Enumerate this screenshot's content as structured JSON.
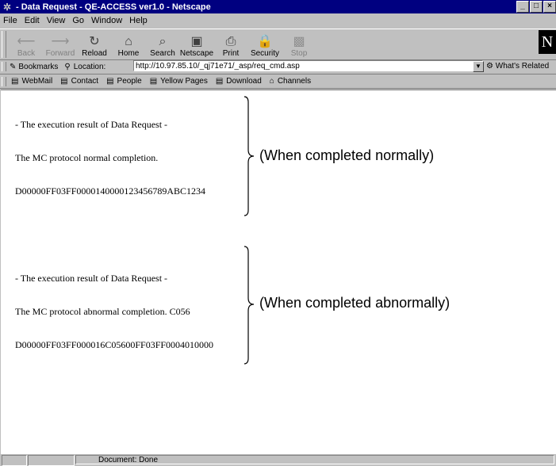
{
  "window": {
    "title": "- Data Request - QE-ACCESS ver1.0 - Netscape"
  },
  "menu": [
    "File",
    "Edit",
    "View",
    "Go",
    "Window",
    "Help"
  ],
  "toolbar": [
    {
      "label": "Back",
      "icon": "back-arrow-icon",
      "glyph": "⟵",
      "enabled": false
    },
    {
      "label": "Forward",
      "icon": "forward-arrow-icon",
      "glyph": "⟶",
      "enabled": false
    },
    {
      "label": "Reload",
      "icon": "reload-icon",
      "glyph": "↻",
      "enabled": true
    },
    {
      "label": "Home",
      "icon": "home-icon",
      "glyph": "⌂",
      "enabled": true
    },
    {
      "label": "Search",
      "icon": "search-icon",
      "glyph": "⌕",
      "enabled": true
    },
    {
      "label": "Netscape",
      "icon": "netscape-icon",
      "glyph": "▣",
      "enabled": true
    },
    {
      "label": "Print",
      "icon": "print-icon",
      "glyph": "⎙",
      "enabled": true
    },
    {
      "label": "Security",
      "icon": "lock-icon",
      "glyph": "🔒",
      "enabled": true
    },
    {
      "label": "Stop",
      "icon": "stop-icon",
      "glyph": "▩",
      "enabled": false
    }
  ],
  "location": {
    "bookmarks": "Bookmarks",
    "label": "Location:",
    "url": "http://10.97.85.10/_qj71e71/_asp/req_cmd.asp",
    "related": "What's Related"
  },
  "links": [
    "WebMail",
    "Contact",
    "People",
    "Yellow Pages",
    "Download",
    "Channels"
  ],
  "normal": {
    "lines": [
      "- The execution result of Data Request -",
      "The MC protocol normal completion.",
      "D00000FF03FF000014000012345678­9ABC1234"
    ],
    "annotation": "(When completed normally)"
  },
  "abnormal": {
    "lines": [
      "- The execution result of Data Request -",
      "The MC protocol abnormal completion. C056",
      "D00000FF03FF000016C05600FF03FF0004010000"
    ],
    "annotation": "(When completed abnormally)"
  },
  "status": {
    "text": "Document: Done"
  }
}
